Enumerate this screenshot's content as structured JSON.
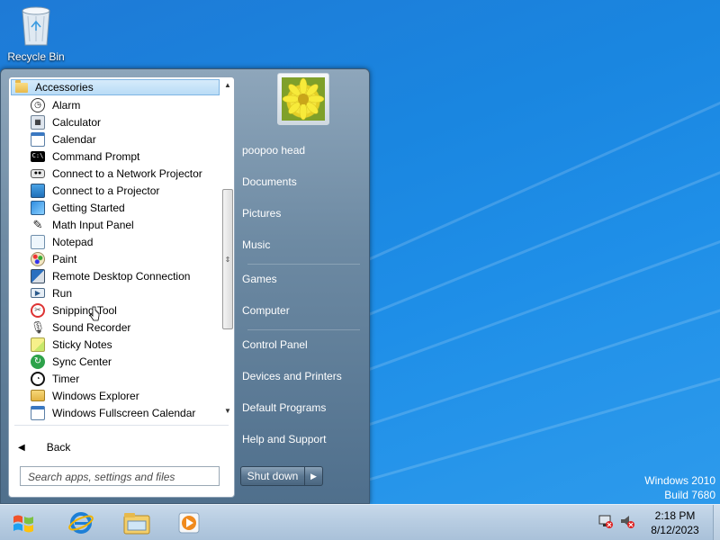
{
  "desktop": {
    "icons": [
      {
        "label": "Recycle Bin",
        "icon": "recycle-bin-icon"
      }
    ],
    "os_version": {
      "line1": "Windows 2010",
      "line2": "Build 7680"
    }
  },
  "start_menu": {
    "folder": "Accessories",
    "programs": [
      {
        "label": "Alarm",
        "icon": "alarm-icon"
      },
      {
        "label": "Calculator",
        "icon": "calculator-icon"
      },
      {
        "label": "Calendar",
        "icon": "calendar-icon"
      },
      {
        "label": "Command Prompt",
        "icon": "command-prompt-icon"
      },
      {
        "label": "Connect to a Network Projector",
        "icon": "network-projector-icon"
      },
      {
        "label": "Connect to a Projector",
        "icon": "projector-icon"
      },
      {
        "label": "Getting Started",
        "icon": "getting-started-icon"
      },
      {
        "label": "Math Input Panel",
        "icon": "math-input-icon"
      },
      {
        "label": "Notepad",
        "icon": "notepad-icon"
      },
      {
        "label": "Paint",
        "icon": "paint-icon"
      },
      {
        "label": "Remote Desktop Connection",
        "icon": "remote-desktop-icon"
      },
      {
        "label": "Run",
        "icon": "run-icon"
      },
      {
        "label": "Snipping Tool",
        "icon": "snipping-tool-icon"
      },
      {
        "label": "Sound Recorder",
        "icon": "sound-recorder-icon"
      },
      {
        "label": "Sticky Notes",
        "icon": "sticky-notes-icon"
      },
      {
        "label": "Sync Center",
        "icon": "sync-center-icon"
      },
      {
        "label": "Timer",
        "icon": "timer-icon"
      },
      {
        "label": "Windows Explorer",
        "icon": "windows-explorer-icon"
      },
      {
        "label": "Windows Fullscreen Calendar",
        "icon": "fullscreen-calendar-icon"
      }
    ],
    "back_label": "Back",
    "search_placeholder": "Search apps, settings and files",
    "user_name": "poopoo head",
    "right_links": [
      {
        "label": "Documents"
      },
      {
        "label": "Pictures"
      },
      {
        "label": "Music"
      },
      {
        "label": "Games"
      },
      {
        "label": "Computer"
      },
      {
        "label": "Control Panel"
      },
      {
        "label": "Devices and Printers"
      },
      {
        "label": "Default Programs"
      },
      {
        "label": "Help and Support"
      }
    ],
    "shutdown_label": "Shut down"
  },
  "taskbar": {
    "pinned": [
      {
        "icon": "internet-explorer-icon"
      },
      {
        "icon": "file-explorer-icon"
      },
      {
        "icon": "media-player-icon"
      }
    ],
    "tray": [
      {
        "icon": "network-icon"
      },
      {
        "icon": "volume-muted-icon"
      }
    ],
    "clock": {
      "time": "2:18 PM",
      "date": "8/12/2023"
    }
  },
  "colors": {
    "desktop": "#1a86e0",
    "start_panel": "#5b7791",
    "selection": "#b9dcf6",
    "taskbar": "#b8cde2"
  }
}
